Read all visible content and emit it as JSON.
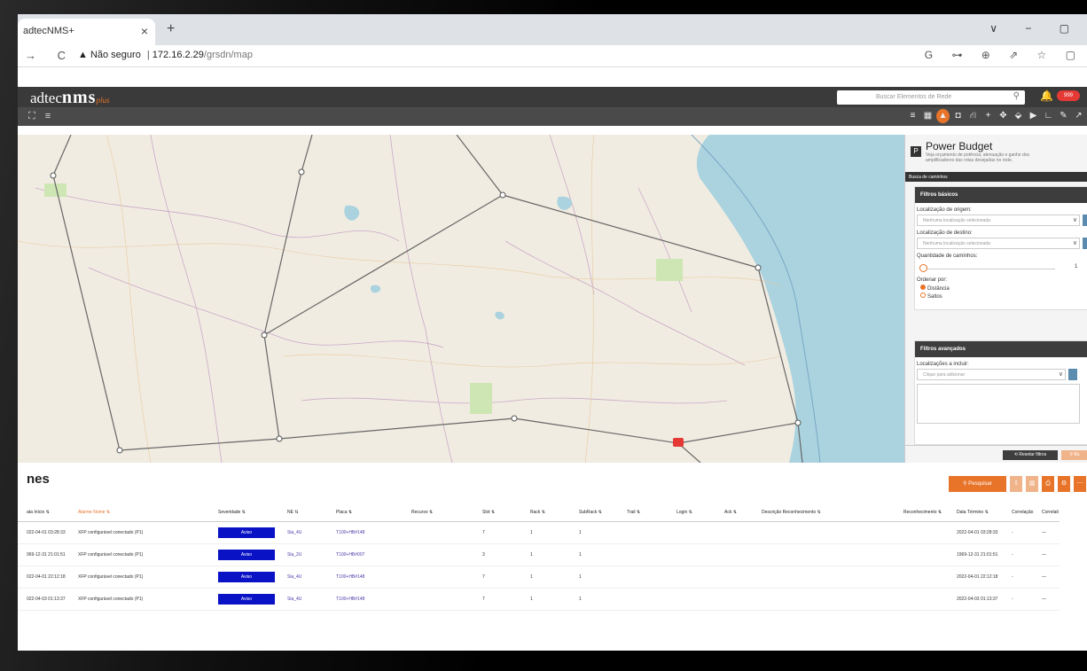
{
  "browser": {
    "tab_title": "adtecNMS+",
    "tab_close": "×",
    "new_tab": "+",
    "window_controls": "∨ − ▢",
    "nav_icons": "→ C",
    "security_warning": "▲ Não seguro",
    "url_host": "172.16.2.29",
    "url_path": "/grsdn/map",
    "toolbar_icons": "G ⊶ ⊕ ⇗ ☆ ▢"
  },
  "app": {
    "logo_prefix": "adtec",
    "logo_main": "nms",
    "logo_plus": "plus",
    "search_placeholder": "Buscar Elementos de Rede",
    "alarm_badge": "999",
    "toolbar_left": "⛶ ≡",
    "toolbar_buttons": [
      "≡",
      "▦",
      "▲",
      "◘",
      "⛙",
      "+",
      "✥",
      "⬙",
      "▶",
      "∟",
      "✎",
      "↗"
    ]
  },
  "map": {
    "ocean_color": "#aad3df",
    "land_color": "#f1ece1",
    "route_color": "#666666",
    "alarm_color": "#e53935"
  },
  "panel": {
    "title": "Power Budget",
    "description": "Veja orçamento de potência, atenuação e ganho dos amplificadores das rotas desejadas no rede.",
    "section": "Busca de caminhos",
    "basic_filters_title": "Filtros básicos",
    "origin_label": "Localização de origem:",
    "origin_placeholder": "Nenhuma localização selecionada",
    "dest_label": "Localização de destino:",
    "dest_placeholder": "Nenhuma localização selecionada",
    "paths_label": "Quantidade de caminhos:",
    "paths_value": "1",
    "order_label": "Ordenar por:",
    "order_options": [
      "Distância",
      "Saltos"
    ],
    "advanced_filters_title": "Filtros avançados",
    "include_label": "Localizações a incluir:",
    "include_placeholder": "Clique para adicionar",
    "reset_button": "⟲ Resetar filtros",
    "search_button": "⚲ Bu"
  },
  "alarms": {
    "title": "nes",
    "search_button": "⚲ Pesquisar",
    "columns": [
      "ata Início ⇅",
      "Alarme Nome ⇅",
      "Severidade ⇅",
      "NE ⇅",
      "Placa ⇅",
      "Recurso ⇅",
      "Slot ⇅",
      "Rack ⇅",
      "SubRack ⇅",
      "Trail ⇅",
      "Login ⇅",
      "Ack ⇅",
      "Descrição Reconhecimento ⇅",
      "Reconhecimento ⇅",
      "Data Término ⇅",
      "Correlação",
      "Correlati"
    ],
    "rows": [
      [
        "022-04-01 03:28:33",
        "XFP configurável conectado (P1)",
        "Aviso",
        "Sla_4U",
        "T100+HB#148",
        "",
        "7",
        "1",
        "1",
        "",
        "",
        "",
        "",
        "",
        "2022-04-01 03:28:33",
        "-",
        "—"
      ],
      [
        "969-12-31 21:01:51",
        "XFP configurável conectado (P1)",
        "Aviso",
        "Sla_2U",
        "T100+HB#007",
        "",
        "3",
        "1",
        "1",
        "",
        "",
        "",
        "",
        "",
        "1969-12-31 21:01:51",
        "-",
        "—"
      ],
      [
        "022-04-01 22:12:18",
        "XFP configurável conectado (P1)",
        "Aviso",
        "Sla_4U",
        "T100+HB#148",
        "",
        "7",
        "1",
        "1",
        "",
        "",
        "",
        "",
        "",
        "2022-04-01 22:12:18",
        "-",
        "—"
      ],
      [
        "022-04-03 01:13:37",
        "XFP configurável conectado (P1)",
        "Aviso",
        "Sla_4U",
        "T100+HB#148",
        "",
        "7",
        "1",
        "1",
        "",
        "",
        "",
        "",
        "",
        "2022-04-03 01:13:37",
        "-",
        "—"
      ]
    ]
  }
}
